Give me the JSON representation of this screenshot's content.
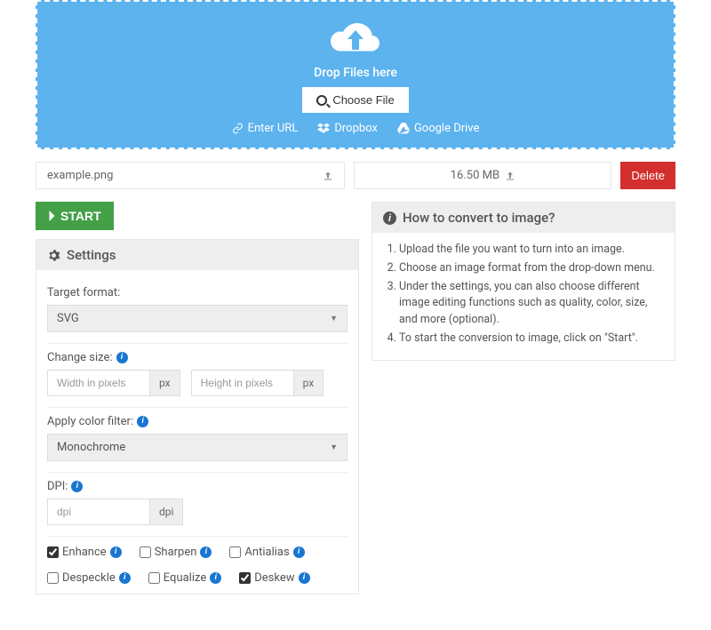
{
  "dropzone": {
    "drop_label": "Drop Files here",
    "choose_label": "Choose File",
    "alt_url": "Enter URL",
    "alt_dropbox": "Dropbox",
    "alt_gdrive": "Google Drive"
  },
  "file": {
    "name": "example.png",
    "size": "16.50 MB",
    "delete_label": "Delete"
  },
  "start_label": "START",
  "settings": {
    "header": "Settings",
    "target_format_label": "Target format:",
    "target_format_value": "SVG",
    "change_size_label": "Change size:",
    "width_placeholder": "Width in pixels",
    "height_placeholder": "Height in pixels",
    "px_unit": "px",
    "color_filter_label": "Apply color filter:",
    "color_filter_value": "Monochrome",
    "dpi_label": "DPI:",
    "dpi_placeholder": "dpi",
    "dpi_unit": "dpi",
    "checks": {
      "enhance": "Enhance",
      "sharpen": "Sharpen",
      "antialias": "Antialias",
      "despeckle": "Despeckle",
      "equalize": "Equalize",
      "deskew": "Deskew"
    }
  },
  "howto": {
    "header": "How to convert to image?",
    "steps": [
      "Upload the file you want to turn into an image.",
      "Choose an image format from the drop-down menu.",
      "Under the settings, you can also choose different image editing functions such as quality, color, size, and more (optional).",
      "To start the conversion to image, click on \"Start\"."
    ]
  }
}
